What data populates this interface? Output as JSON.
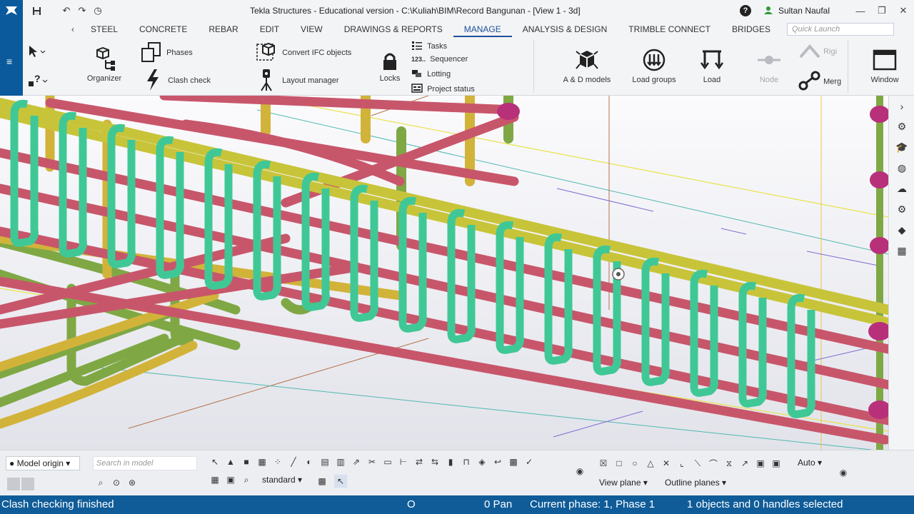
{
  "titlebar": {
    "title": "Tekla Structures - Educational version - C:\\Kuliah\\BIM\\Record Bangunan - [View 1 - 3d]",
    "user": "Sultan Naufal",
    "help": "?"
  },
  "tabs": [
    "STEEL",
    "CONCRETE",
    "REBAR",
    "EDIT",
    "VIEW",
    "DRAWINGS & REPORTS",
    "MANAGE",
    "ANALYSIS & DESIGN",
    "TRIMBLE CONNECT",
    "BRIDGES"
  ],
  "active_tab": "MANAGE",
  "quick_launch_placeholder": "Quick Launch",
  "ribbon": {
    "organizer": "Organizer",
    "phases": "Phases",
    "clash_check": "Clash check",
    "convert_ifc": "Convert IFC objects",
    "layout_manager": "Layout manager",
    "locks": "Locks",
    "tasks": "Tasks",
    "sequencer": "Sequencer",
    "lotting": "Lotting",
    "project_status": "Project status",
    "ad_models": "A & D models",
    "load_groups": "Load groups",
    "load": "Load",
    "node": "Node",
    "rigid": "Rigi",
    "merge": "Merg",
    "window": "Window"
  },
  "bottom": {
    "model_origin": "Model origin",
    "search_placeholder": "Search in model",
    "standard": "standard",
    "auto": "Auto",
    "view_plane": "View plane",
    "outline_planes": "Outline planes"
  },
  "status": {
    "message": "Clash checking finished",
    "zero": "O",
    "pan": "0 Pan",
    "phase": "Current phase: 1, Phase 1",
    "selection": "1 objects and 0 handles selected"
  },
  "colors": {
    "brand": "#0a5a9c",
    "active_tab": "#1e4f9c",
    "stirrup": "#3fc896",
    "main_bar_red": "#c8566b",
    "main_bar_yellow": "#c8c43a",
    "column_bar": "#d2b33a",
    "green_bar": "#7fa845",
    "status_bg": "#0f5c99"
  },
  "icons": [
    "select-arrow-icon",
    "help-select-icon",
    "organizer-icon",
    "phases-icon",
    "clash-check-icon",
    "convert-ifc-icon",
    "layout-manager-icon",
    "lock-icon",
    "tasks-icon",
    "sequencer-icon",
    "lotting-icon",
    "project-status-icon",
    "ad-models-icon",
    "load-groups-icon",
    "load-icon",
    "node-icon",
    "rigid-link-icon",
    "merge-icon",
    "window-icon"
  ]
}
